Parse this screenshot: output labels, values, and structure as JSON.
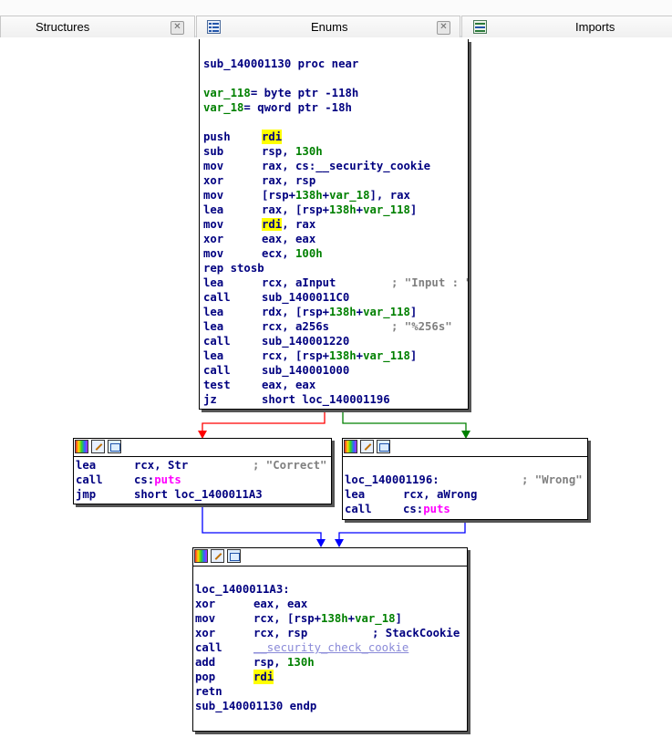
{
  "tabs": {
    "structures": {
      "label": "Structures"
    },
    "enums": {
      "label": "Enums"
    },
    "imports": {
      "label": "Imports"
    }
  },
  "blocks": {
    "entry": {
      "proc_header": "sub_140001130 proc near",
      "var1_name": "var_118",
      "var1_rest": "= byte ptr -118h",
      "var2_name": "var_18",
      "var2_rest": "= qword ptr -18h",
      "instructions": [
        {
          "mnemonic": "push",
          "op1": "rdi"
        },
        {
          "mnemonic": "sub",
          "op1": "rsp, ",
          "op2": "130h"
        },
        {
          "mnemonic": "mov",
          "op1": "rax, cs:__security_cookie"
        },
        {
          "mnemonic": "xor",
          "op1": "rax, rsp"
        },
        {
          "mnemonic": "mov",
          "op1": "[rsp+",
          "op2": "138h",
          "op3": "+",
          "op4": "var_18",
          "op5": "], rax"
        },
        {
          "mnemonic": "lea",
          "op1": "rax, [rsp+",
          "op2": "138h",
          "op3": "+",
          "op4": "var_118",
          "op5": "]"
        },
        {
          "mnemonic": "mov",
          "op1": "rdi",
          "op2": ", rax"
        },
        {
          "mnemonic": "xor",
          "op1": "eax, eax"
        },
        {
          "mnemonic": "mov",
          "op1": "ecx, ",
          "op2": "100h"
        },
        {
          "mnemonic": "rep stosb"
        },
        {
          "mnemonic": "lea",
          "op1": "rcx, aInput",
          "comment": "; \"Input : \""
        },
        {
          "mnemonic": "call",
          "op1": "sub_1400011C0"
        },
        {
          "mnemonic": "lea",
          "op1": "rdx, [rsp+",
          "op2": "138h",
          "op3": "+",
          "op4": "var_118",
          "op5": "]"
        },
        {
          "mnemonic": "lea",
          "op1": "rcx, a256s",
          "comment": "; \"%256s\""
        },
        {
          "mnemonic": "call",
          "op1": "sub_140001220"
        },
        {
          "mnemonic": "lea",
          "op1": "rcx, [rsp+",
          "op2": "138h",
          "op3": "+",
          "op4": "var_118",
          "op5": "]"
        },
        {
          "mnemonic": "call",
          "op1": "sub_140001000"
        },
        {
          "mnemonic": "test",
          "op1": "eax, eax"
        },
        {
          "mnemonic": "jz",
          "op1": "short loc_140001196"
        }
      ]
    },
    "correct": {
      "l1_mn": "lea",
      "l1_op": "rcx, Str",
      "l1_cmt": "; \"Correct\"",
      "l2_mn": "call",
      "l2_op": "cs:",
      "l2_fn": "puts",
      "l3_mn": "jmp",
      "l3_op": "short loc_1400011A3"
    },
    "wrong": {
      "label": "loc_140001196:",
      "label_cmt": "; \"Wrong\"",
      "l1_mn": "lea",
      "l1_op": "rcx, aWrong",
      "l2_mn": "call",
      "l2_op": "cs:",
      "l2_fn": "puts"
    },
    "exit": {
      "label": "loc_1400011A3:",
      "l1_mn": "xor",
      "l1_op": "eax, eax",
      "l2_mn": "mov",
      "l2_a": "rcx, [rsp+",
      "l2_b": "138h",
      "l2_c": "+",
      "l2_d": "var_18",
      "l2_e": "]",
      "l3_mn": "xor",
      "l3_op": "rcx, rsp",
      "l3_cmt": "; StackCookie",
      "l4_mn": "call",
      "l4_op": "__security_check_cookie",
      "l5_mn": "add",
      "l5_a": "rsp, ",
      "l5_b": "130h",
      "l6_mn": "pop",
      "l6_op": "rdi",
      "l7_mn": "retn",
      "endp": "sub_140001130 endp"
    }
  },
  "colors": {
    "text": "#000080",
    "number": "#008000",
    "comment": "#808080",
    "import": "#ff00ff",
    "highlight": "#ffff00",
    "edge_false": "#ff0000",
    "edge_true": "#008000",
    "edge_uncond": "#0000ff"
  },
  "icons": [
    "structures-icon",
    "enums-icon",
    "imports-icon",
    "close-icon",
    "color-icon",
    "edit-icon",
    "graph-icon"
  ]
}
